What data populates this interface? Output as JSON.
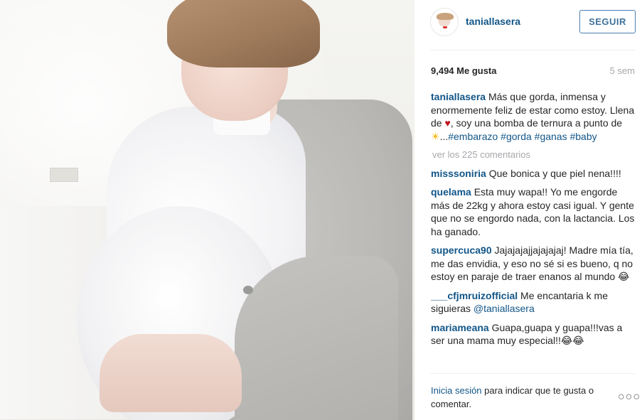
{
  "post": {
    "username": "taniallasera",
    "follow_label": "SEGUIR",
    "likes": "9,494 Me gusta",
    "age": "5 sem"
  },
  "caption": {
    "user": "taniallasera",
    "text_part1": " Más que gorda, inmensa y enormemente feliz de estar como estoy. Llena de ",
    "heart": "♥",
    "text_part2": ", soy una bomba de ternura a punto de ",
    "sun": "☀",
    "text_part3": "...",
    "hashtags": [
      "#embarazo",
      "#gorda",
      "#ganas",
      "#baby"
    ]
  },
  "more_comments": "ver los 225 comentarios",
  "comments": [
    {
      "user": "misssoniria",
      "text": " Que bonica y que piel nena!!!!"
    },
    {
      "user": "quelama",
      "text": " Esta muy wapa!! Yo me engorde más de 22kg y ahora estoy casi igual. Y gente que no se engordo nada, con la lactancia. Los ha ganado."
    },
    {
      "user": "supercuca90",
      "text": " Jajajajajjajajajaj! Madre mía tía, me das envidia, y eso no sé si es bueno, q no estoy en paraje de traer enanos al mundo 😂"
    },
    {
      "user": "___cfjmruizofficial",
      "text": " Me encantaria k me siguieras ",
      "mention": "@taniallasera"
    },
    {
      "user": "mariameana",
      "text": " Guapa,guapa y guapa!!!vas a ser una mama muy especial!!😂😂"
    }
  ],
  "footer": {
    "login": "Inicia sesión",
    "rest": " para indicar que te gusta o comentar.",
    "more_icon": "ellipsis-icon",
    "more_glyph": "○○○"
  }
}
